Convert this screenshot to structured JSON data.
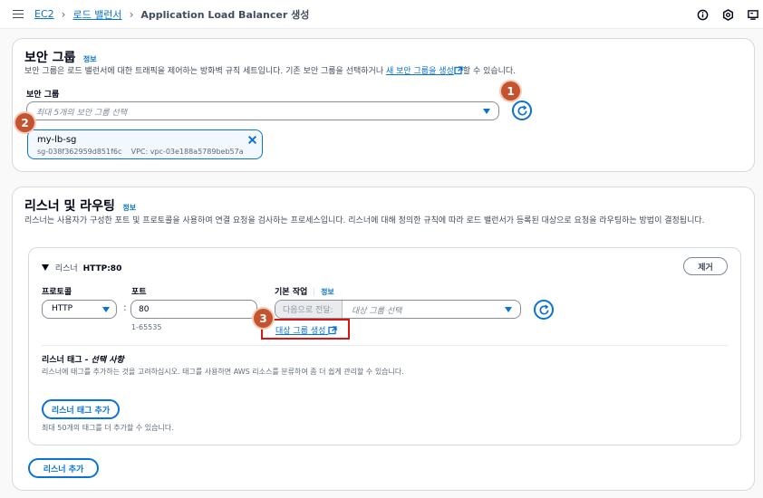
{
  "breadcrumb": {
    "ec2": "EC2",
    "lb": "로드 밸런서",
    "current": "Application Load Balancer 생성"
  },
  "security_group": {
    "title": "보안 그룹",
    "info": "정보",
    "desc_before": "보안 그룹은 로드 밸런서에 대한 트래픽을 제어하는 방화벽 규칙 세트입니다. 기존 보안 그룹을 선택하거나 ",
    "create_link": "새 보안 그룹을 생성",
    "desc_after": "할 수 있습니다.",
    "field_label": "보안 그룹",
    "select_placeholder": "최대 5개의 보안 그룹 선택",
    "token": {
      "name": "my-lb-sg",
      "id": "sg-038f362959d851f6c",
      "vpc": "VPC: vpc-03e188a5789beb57a"
    }
  },
  "listeners": {
    "title": "리스너 및 라우팅",
    "info": "정보",
    "desc": "리스너는 사용자가 구성한 포트 및 프로토콜을 사용하여 연결 요청을 검사하는 프로세스입니다. 리스너에 대해 정의한 규칙에 따라 로드 밸런서가 등록된 대상으로 요청을 라우팅하는 방법이 결정됩니다.",
    "listener": {
      "header_prefix": "리스너",
      "header_name": "HTTP:80",
      "remove": "제거",
      "protocol_label": "프로토콜",
      "protocol_value": "HTTP",
      "port_label": "포트",
      "port_value": "80",
      "port_hint": "1-65535",
      "default_action_label": "기본 작업",
      "default_action_info": "정보",
      "forward_to": "다음으로 전달:",
      "target_placeholder": "대상 그룹 선택",
      "create_target_group": "대상 그룹 생성",
      "tags_title": "리스너 태그 - ",
      "tags_optional": "선택 사항",
      "tags_desc": "리스너에 태그를 추가하는 것을 고려하십시오. 태그를 사용하면 AWS 리소스를 분류하여 좀 더 쉽게 관리할 수 있습니다.",
      "add_tag": "리스너 태그 추가",
      "tag_limit": "최대 50개의 태그를 더 추가할 수 있습니다."
    },
    "add_listener": "리스너 추가"
  },
  "badges": [
    "1",
    "2",
    "3"
  ],
  "colors": {
    "link": "#0972d3",
    "badge": "#c4532f",
    "highlight": "#d91515"
  },
  "icons": [
    "menu-icon",
    "info-circle-icon",
    "settings-icon",
    "notifications-icon",
    "refresh-icon",
    "external-link-icon",
    "caret-down-icon",
    "close-icon",
    "expand-triangle-icon"
  ]
}
